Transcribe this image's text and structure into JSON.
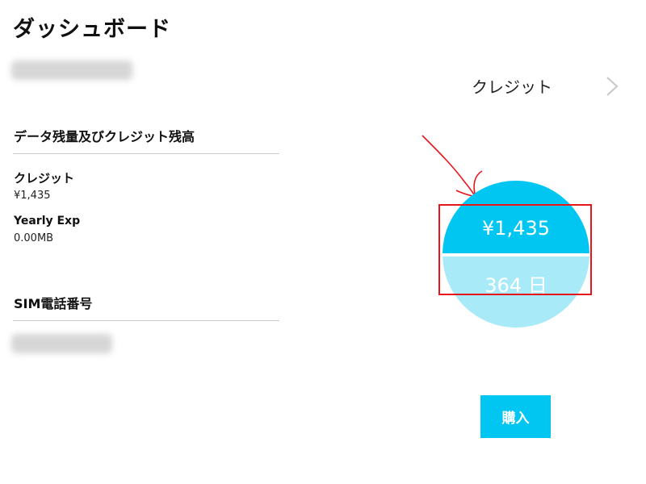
{
  "page": {
    "title": "ダッシュボード"
  },
  "nav": {
    "credit_label": "クレジット",
    "chevron_icon": "chevron-right-icon"
  },
  "data_section": {
    "heading": "データ残量及びクレジット残高",
    "credit_label": "クレジット",
    "credit_value": "¥1,435",
    "yearly_label": "Yearly Exp",
    "yearly_value": "0.00MB"
  },
  "sim_section": {
    "heading": "SIM電話番号"
  },
  "balance_circle": {
    "balance": "¥1,435",
    "days": "364 日",
    "top_color": "#00c6f1",
    "bottom_color": "#a8eaf8"
  },
  "annotation": {
    "box_color": "#e8151b",
    "arrow_color": "#e8151b"
  },
  "actions": {
    "buy_label": "購入"
  }
}
